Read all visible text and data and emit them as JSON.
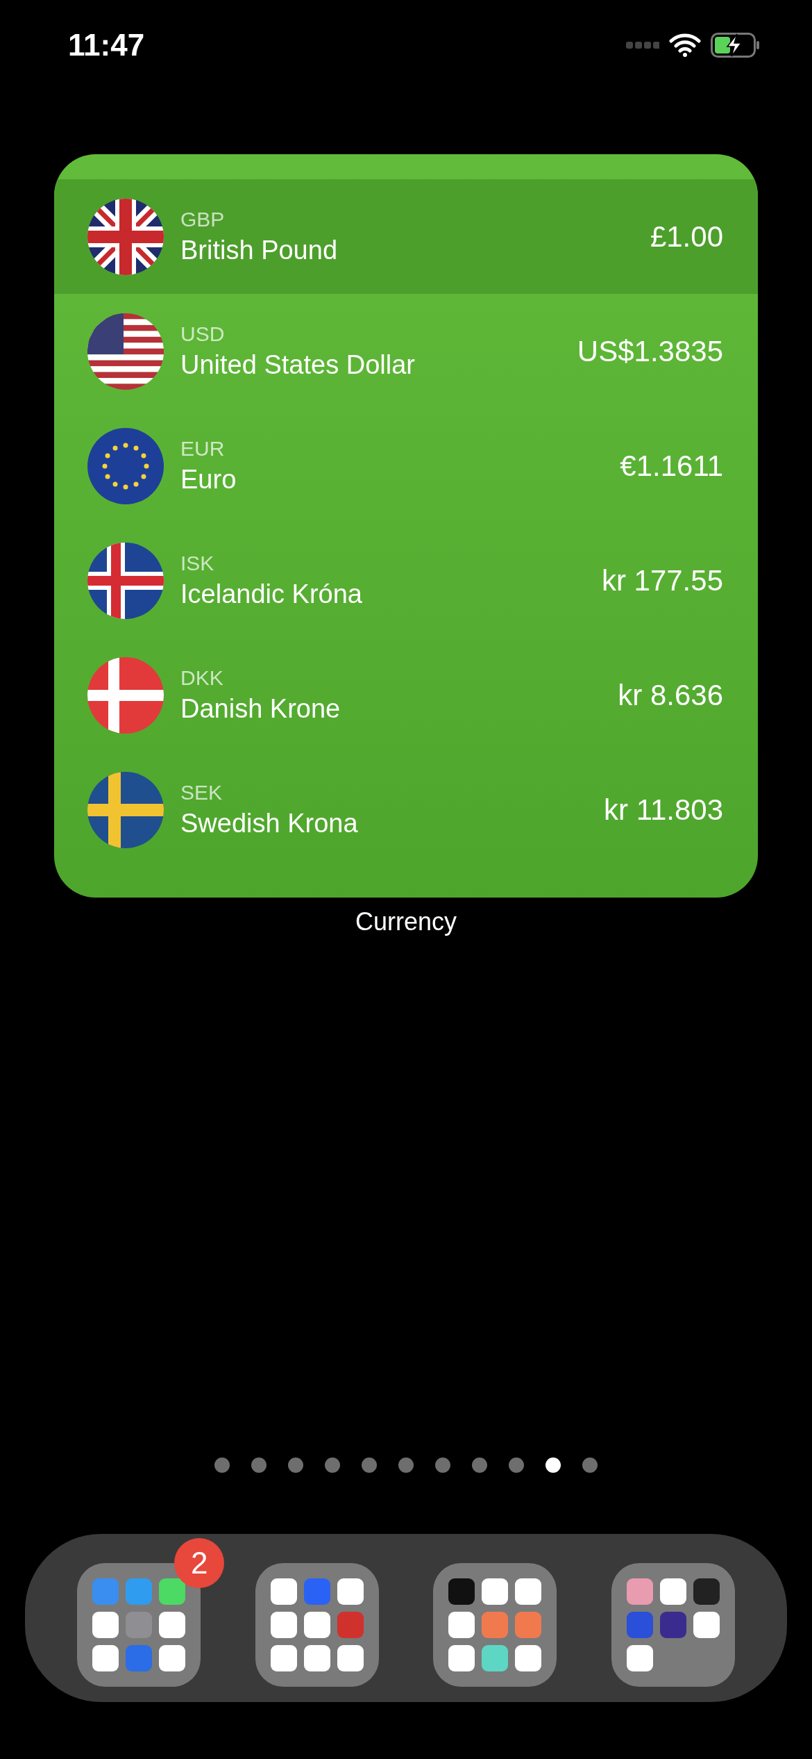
{
  "status_bar": {
    "time": "11:47"
  },
  "widget": {
    "label": "Currency",
    "rows": [
      {
        "code": "GBP",
        "name": "British Pound",
        "amount": "£1.00",
        "kind": "gb",
        "selected": true
      },
      {
        "code": "USD",
        "name": "United States Dollar",
        "amount": "US$1.3835",
        "kind": "us",
        "selected": false
      },
      {
        "code": "EUR",
        "name": "Euro",
        "amount": "€1.1611",
        "kind": "eu",
        "selected": false
      },
      {
        "code": "ISK",
        "name": "Icelandic Króna",
        "amount": "kr 177.55",
        "kind": "is",
        "selected": false
      },
      {
        "code": "DKK",
        "name": "Danish Krone",
        "amount": "kr 8.636",
        "kind": "dk",
        "selected": false
      },
      {
        "code": "SEK",
        "name": "Swedish Krona",
        "amount": "kr 11.803",
        "kind": "se",
        "selected": false
      }
    ]
  },
  "page_dots": [
    {
      "selected": false
    },
    {
      "selected": false
    },
    {
      "selected": false
    },
    {
      "selected": false
    },
    {
      "selected": false
    },
    {
      "selected": false
    },
    {
      "selected": false
    },
    {
      "selected": false
    },
    {
      "selected": false
    },
    {
      "selected": true
    },
    {
      "selected": false
    }
  ],
  "dock": {
    "folders": [
      {
        "badge": "2",
        "apps": [
          {
            "color": "#3a8ef0"
          },
          {
            "color": "#2f9cf0"
          },
          {
            "color": "#4cd964"
          },
          {
            "color": "#ffffff"
          },
          {
            "color": "#8e8e93"
          },
          {
            "color": "#ffffff"
          },
          {
            "color": "#ffffff"
          },
          {
            "color": "#2b6de6"
          },
          {
            "color": "#ffffff"
          }
        ]
      },
      {
        "apps": [
          {
            "color": "#ffffff"
          },
          {
            "color": "#2a62f5"
          },
          {
            "color": "#ffffff"
          },
          {
            "color": "#ffffff"
          },
          {
            "color": "#ffffff"
          },
          {
            "color": "#d0312d"
          },
          {
            "color": "#ffffff"
          },
          {
            "color": "#ffffff"
          },
          {
            "color": "#ffffff"
          }
        ]
      },
      {
        "apps": [
          {
            "color": "#111111"
          },
          {
            "color": "#ffffff"
          },
          {
            "color": "#ffffff"
          },
          {
            "color": "#ffffff"
          },
          {
            "color": "#f07a4e"
          },
          {
            "color": "#f07a4e"
          },
          {
            "color": "#ffffff"
          },
          {
            "color": "#5ed6c4"
          },
          {
            "color": "#ffffff"
          }
        ]
      },
      {
        "apps": [
          {
            "color": "#e99bb0"
          },
          {
            "color": "#ffffff"
          },
          {
            "color": "#222222"
          },
          {
            "color": "#2a4fd8"
          },
          {
            "color": "#3a2c8f"
          },
          {
            "color": "#ffffff"
          },
          {
            "color": "#ffffff"
          }
        ]
      }
    ]
  }
}
